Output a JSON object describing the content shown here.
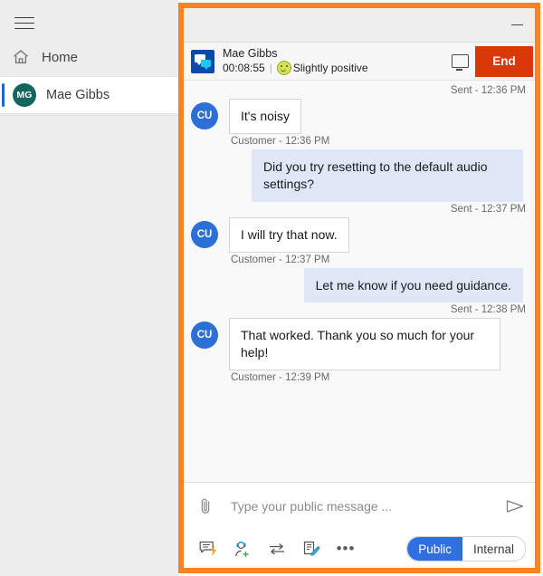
{
  "sidebar": {
    "menu_icon": "hamburger-icon",
    "items": [
      {
        "label": "Home",
        "icon": "home-icon"
      },
      {
        "label": "Mae Gibbs",
        "icon": "avatar",
        "initials": "MG",
        "active": true
      }
    ]
  },
  "window": {
    "minimize_label": "—",
    "border_color": "#fa8223"
  },
  "conversation_header": {
    "icon": "chat-icon",
    "name": "Mae Gibbs",
    "timer": "00:08:55",
    "separator": "|",
    "sentiment_icon": "slightly-positive-smiley-icon",
    "sentiment": "Slightly positive",
    "monitor_icon": "monitor-icon",
    "end_label": "End",
    "end_color": "#d9380a"
  },
  "messages": [
    {
      "direction": "out",
      "stamp": "Sent - 12:36 PM",
      "stamp_position": "above",
      "text": null
    },
    {
      "direction": "in",
      "avatar": "CU",
      "text": "It's noisy",
      "stamp": "Customer - 12:36 PM"
    },
    {
      "direction": "out",
      "text": "Did you try resetting to the default audio settings?",
      "stamp": "Sent - 12:37 PM"
    },
    {
      "direction": "in",
      "avatar": "CU",
      "text": "I will try that now.",
      "stamp": "Customer - 12:37 PM"
    },
    {
      "direction": "out",
      "text": "Let me know if you need guidance.",
      "stamp": "Sent - 12:38 PM"
    },
    {
      "direction": "in",
      "avatar": "CU",
      "text": "That worked. Thank you so much for your help!",
      "stamp": "Customer - 12:39 PM"
    }
  ],
  "composer": {
    "attach_icon": "paperclip-icon",
    "placeholder": "Type your public message ...",
    "value": "",
    "send_icon": "send-icon",
    "tools": [
      {
        "name": "quick-reply-icon"
      },
      {
        "name": "add-agent-icon"
      },
      {
        "name": "transfer-icon"
      },
      {
        "name": "notes-icon"
      },
      {
        "name": "more-icon",
        "label": "•••"
      }
    ],
    "toggle": {
      "active_label": "Public",
      "inactive_label": "Internal",
      "active_color": "#2f6fe0"
    }
  }
}
